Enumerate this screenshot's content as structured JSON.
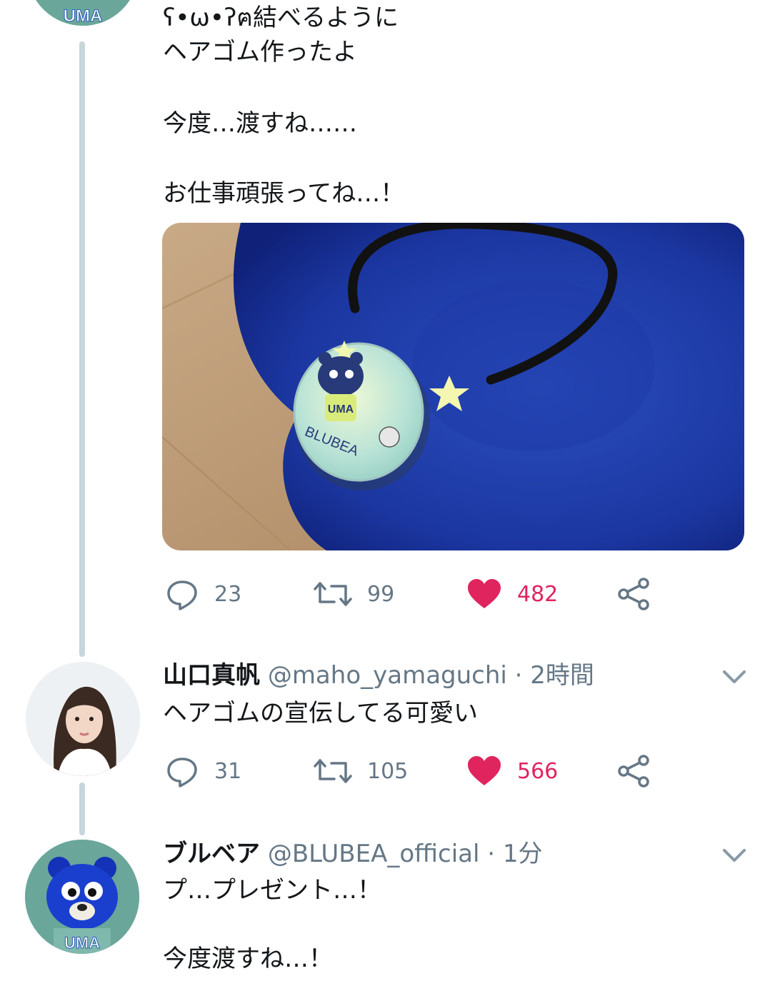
{
  "tweet1": {
    "lines": [
      "ʕ•ω•ʔฅ結べるように",
      "ヘアゴム作ったよ",
      "",
      "今度…渡すね……",
      "",
      "お仕事頑張ってね…！"
    ],
    "media": {
      "badge_text_top": "UMA",
      "badge_text_bottom": "BLUBEA"
    },
    "avatar_text": "UMA",
    "replies": "23",
    "retweets": "99",
    "likes": "482"
  },
  "tweet2": {
    "name": "山口真帆",
    "handle": "@maho_yamaguchi",
    "separator": "·",
    "time": "2時間",
    "text": "ヘアゴムの宣伝してる可愛い",
    "replies": "31",
    "retweets": "105",
    "likes": "566"
  },
  "tweet3": {
    "name": "ブルベア",
    "handle": "@BLUBEA_official",
    "separator": "·",
    "time": "1分",
    "lines": [
      "プ…プレゼント…！",
      "",
      "今度渡すね…！"
    ],
    "avatar_text": "UMA"
  },
  "icons": {
    "reply": "reply-icon",
    "retweet": "retweet-icon",
    "like": "heart-icon",
    "share": "share-icon",
    "menu": "chevron-down-icon"
  },
  "colors": {
    "like": "#e0245e",
    "muted": "#657786",
    "thread_line": "#c7d6da"
  }
}
